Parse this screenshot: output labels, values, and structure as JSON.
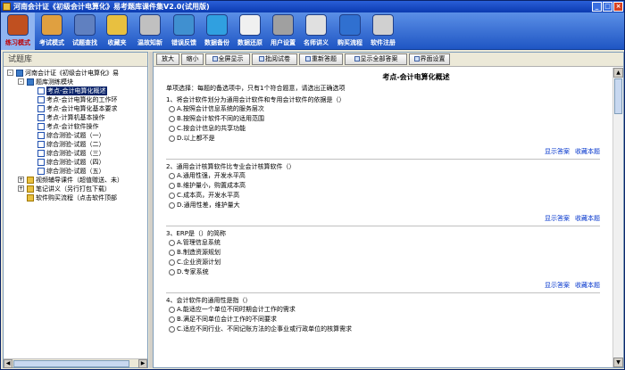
{
  "window": {
    "title": "河南会计证《初级会计电算化》易考题库课件集V2.0(试用版)",
    "buttons": [
      "_",
      "□",
      "×"
    ]
  },
  "toolbar": {
    "items": [
      {
        "label": "练习模式",
        "icon": "books-icon",
        "active": true
      },
      {
        "label": "考试模式",
        "icon": "person-icon"
      },
      {
        "label": "试题查找",
        "icon": "magnifier-icon"
      },
      {
        "label": "收藏夹",
        "icon": "folder-icon"
      },
      {
        "label": "温故知新",
        "icon": "printer-icon"
      },
      {
        "label": "错误反馈",
        "icon": "monitor-icon"
      },
      {
        "label": "数据备份",
        "icon": "globe-icon"
      },
      {
        "label": "数据还原",
        "icon": "refresh-icon"
      },
      {
        "label": "用户设置",
        "icon": "settings-icon"
      },
      {
        "label": "名师讲义",
        "icon": "notebook-icon"
      },
      {
        "label": "购买流程",
        "icon": "ie-icon"
      },
      {
        "label": "软件注册",
        "icon": "register-icon"
      }
    ]
  },
  "left": {
    "header": "试题库",
    "tree": [
      {
        "text": "河南会计证《初级会计电算化》易",
        "level": 0,
        "expander": "-",
        "icon": "book"
      },
      {
        "text": "题库测练模块",
        "level": 1,
        "expander": "-",
        "icon": "book"
      },
      {
        "text": "考点-会计电算化概述",
        "level": 2,
        "icon": "doc",
        "selected": true
      },
      {
        "text": "考点-会计电算化的工作环",
        "level": 2,
        "icon": "doc"
      },
      {
        "text": "考点-会计电算化基本要求",
        "level": 2,
        "icon": "doc"
      },
      {
        "text": "考点-计算机基本操作",
        "level": 2,
        "icon": "doc"
      },
      {
        "text": "考点-会计软件操作",
        "level": 2,
        "icon": "doc"
      },
      {
        "text": "综合测验-试题（一）",
        "level": 2,
        "icon": "doc"
      },
      {
        "text": "综合测验-试题（二）",
        "level": 2,
        "icon": "doc"
      },
      {
        "text": "综合测验-试题（三）",
        "level": 2,
        "icon": "doc"
      },
      {
        "text": "综合测验-试题（四）",
        "level": 2,
        "icon": "doc"
      },
      {
        "text": "综合测验-试题（五）",
        "level": 2,
        "icon": "doc"
      },
      {
        "text": "视频辅导课件（超值赠送、未）",
        "level": 1,
        "expander": "+",
        "icon": "folder"
      },
      {
        "text": "笔记讲义（另行打包下载）",
        "level": 1,
        "expander": "+",
        "icon": "folder"
      },
      {
        "text": "软件购买流程（点击软件顶部",
        "level": 1,
        "icon": "folder"
      }
    ]
  },
  "main": {
    "buttons": [
      {
        "label": "放大",
        "icon": false
      },
      {
        "label": "缩小",
        "icon": false
      },
      {
        "label": "全屏显示",
        "icon": true
      },
      {
        "label": "批阅试卷",
        "icon": true
      },
      {
        "label": "重新答题",
        "icon": true
      },
      {
        "label": "显示全部答案",
        "icon": true
      },
      {
        "label": "界面设置",
        "icon": true
      }
    ],
    "title": "考点-会计电算化概述",
    "intro": "单项选择：每题的备选项中，只有1个符合题意，请选出正确选项",
    "show_answer": "显示答案",
    "favorite": "收藏本题",
    "questions": [
      {
        "text": "1、将会计软件划分为通用会计软件和专用会计软件的依据是（）",
        "options": [
          "A.按照会计信息系统的服务层次",
          "B.按照会计软件不同的适用范围",
          "C.按会计信息的共享功能",
          "D.以上都不是"
        ]
      },
      {
        "text": "2、通用会计核算软件比专业会计核算软件（）",
        "options": [
          "A.通用性强，开发水平高",
          "B.维护量小，购置成本高",
          "C.成本高，开发水平高",
          "D.通用性差，维护量大"
        ]
      },
      {
        "text": "3、ERP是（）的简称",
        "options": [
          "A.管理信息系统",
          "B.制造资源规划",
          "C.企业资源计划",
          "D.专家系统"
        ]
      },
      {
        "text": "4、会计软件的通用性是指（）",
        "options": [
          "A.能适应一个单位不同时期会计工作的需求",
          "B.满足不同单位会计工作的不同要求",
          "C.适应不同行业、不同记账方法的企事业或行政单位的核算需求"
        ]
      }
    ]
  }
}
